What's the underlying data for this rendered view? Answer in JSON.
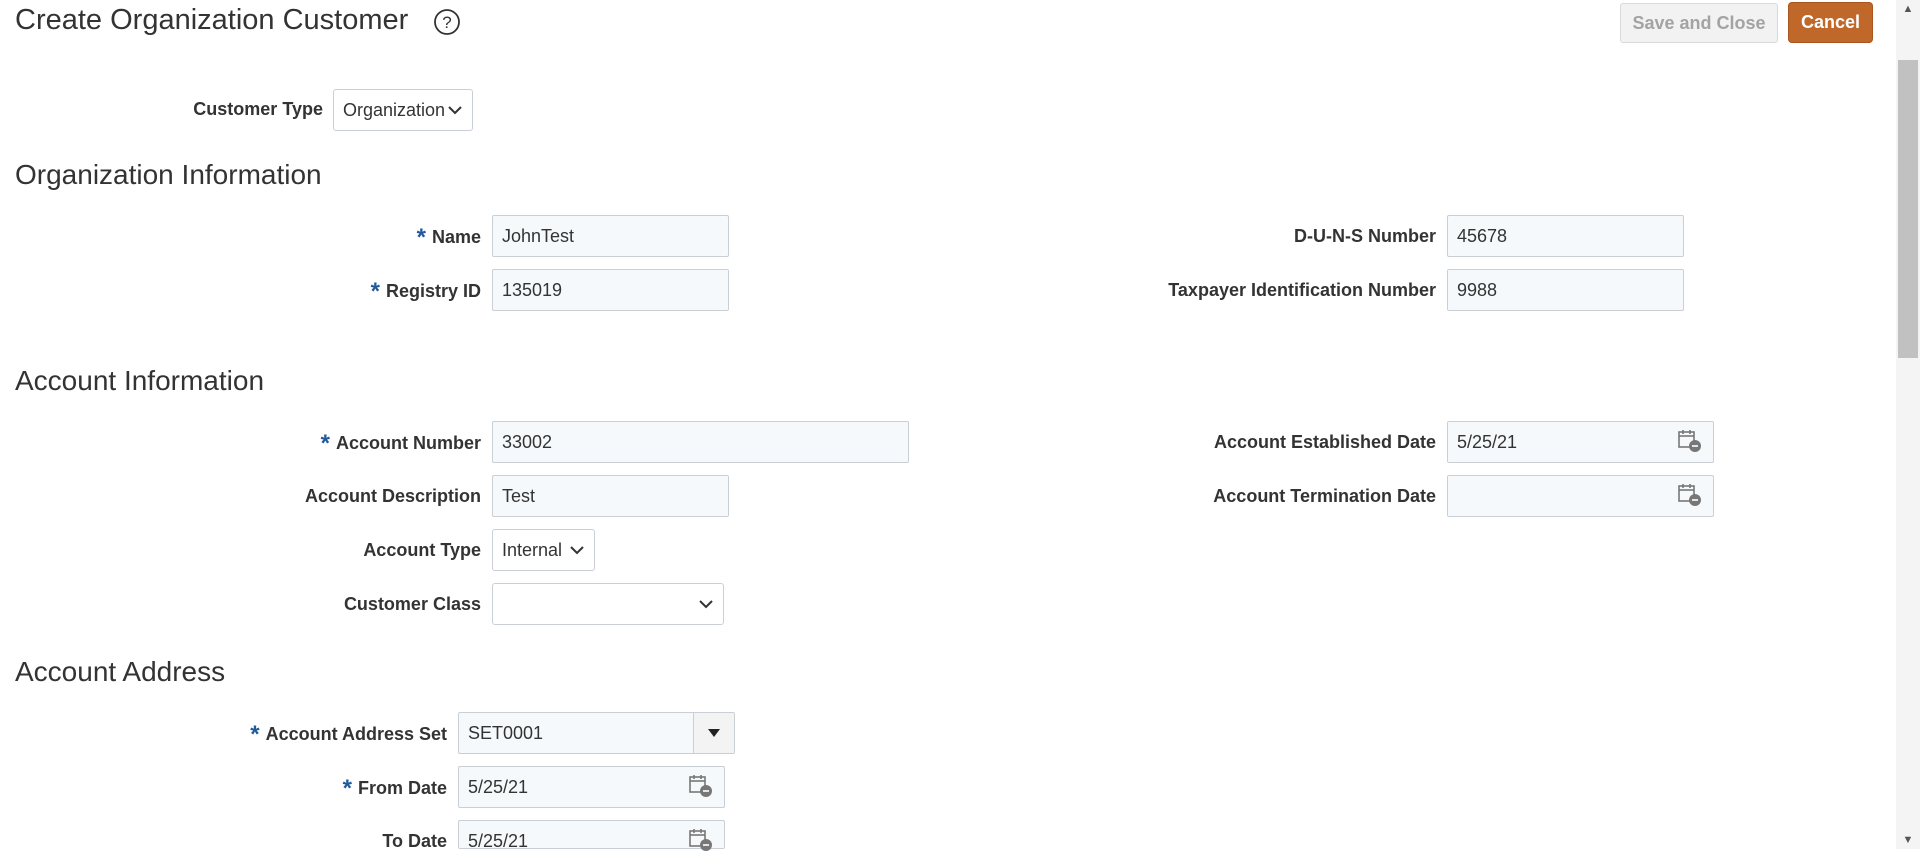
{
  "header": {
    "title": "Create Organization Customer",
    "save_close_label": "Save and Close",
    "cancel_label": "Cancel"
  },
  "customer_type": {
    "label": "Customer Type",
    "value": "Organization"
  },
  "org_info": {
    "title": "Organization Information",
    "name": {
      "label": "Name",
      "value": "JohnTest"
    },
    "registry_id": {
      "label": "Registry ID",
      "value": "135019"
    },
    "duns": {
      "label": "D-U-N-S Number",
      "value": "45678"
    },
    "taxpayer_id": {
      "label": "Taxpayer Identification Number",
      "value": "9988"
    }
  },
  "account_info": {
    "title": "Account Information",
    "account_number": {
      "label": "Account Number",
      "value": "33002"
    },
    "account_description": {
      "label": "Account Description",
      "value": "Test"
    },
    "account_type": {
      "label": "Account Type",
      "value": "Internal"
    },
    "customer_class": {
      "label": "Customer Class",
      "value": ""
    },
    "established_date": {
      "label": "Account Established Date",
      "value": "5/25/21"
    },
    "termination_date": {
      "label": "Account Termination Date",
      "value": ""
    }
  },
  "account_address": {
    "title": "Account Address",
    "address_set": {
      "label": "Account Address Set",
      "value": "SET0001"
    },
    "from_date": {
      "label": "From Date",
      "value": "5/25/21"
    },
    "to_date": {
      "label": "To Date",
      "value": "5/25/21"
    }
  },
  "required_marker": "*"
}
